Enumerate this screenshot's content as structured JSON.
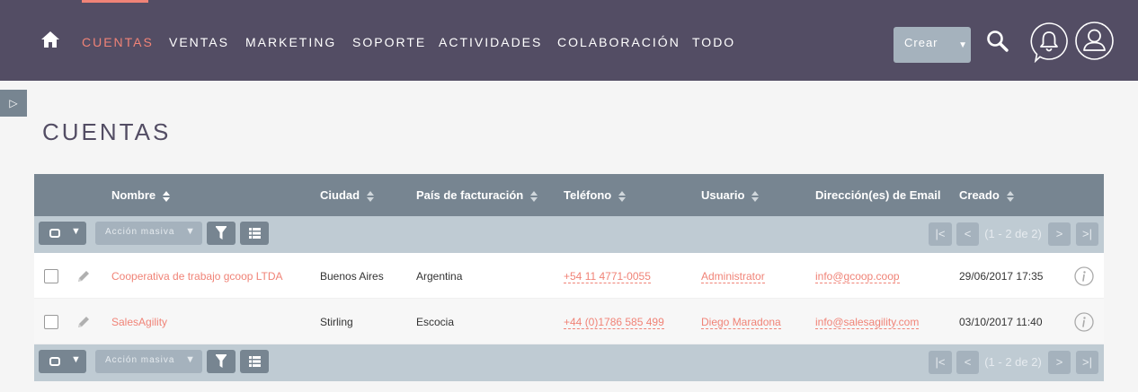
{
  "nav": {
    "items": [
      "CUENTAS",
      "VENTAS",
      "MARKETING",
      "SOPORTE",
      "ACTIVIDADES",
      "COLABORACIÓN",
      "TODO"
    ],
    "active": "CUENTAS",
    "create_label": "Crear",
    "create_caret": "▼"
  },
  "sidebar_toggle": "▷",
  "page_title": "CUENTAS",
  "table": {
    "columns": [
      "Nombre",
      "Ciudad",
      "País de facturación",
      "Teléfono",
      "Usuario",
      "Dirección(es) de Email",
      "Creado"
    ],
    "mass_action_label": "Acción masiva",
    "caret": "▼",
    "pagination": {
      "first": "|<",
      "prev": "<",
      "count": "(1 - 2 de 2)",
      "next": ">",
      "last": ">|"
    },
    "rows": [
      {
        "nombre": "Cooperativa de trabajo gcoop LTDA",
        "ciudad": "Buenos Aires",
        "pais": "Argentina",
        "telefono": "+54 11 4771-0055",
        "usuario": "Administrator",
        "email": "info@gcoop.coop",
        "creado": "29/06/2017 17:35"
      },
      {
        "nombre": "SalesAgility",
        "ciudad": "Stirling",
        "pais": "Escocia",
        "telefono": "+44 (0)1786 585 499",
        "usuario": "Diego Maradona",
        "email": "info@salesagility.com",
        "creado": "03/10/2017 11:40"
      }
    ]
  },
  "colors": {
    "nav_bg": "#534d64",
    "accent": "#f08377",
    "header_bg": "#778591",
    "pagebar_bg": "#bfcbd3"
  }
}
